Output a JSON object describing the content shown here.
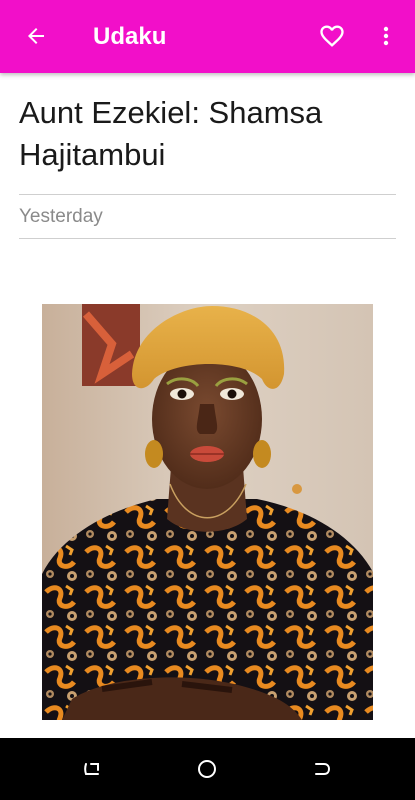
{
  "app_bar": {
    "title": "Udaku",
    "background": "#F20FC9",
    "back_icon": "arrow-back-icon",
    "favorite_icon": "heart-outline-icon",
    "menu_icon": "more-vert-icon"
  },
  "article": {
    "headline": "Aunt Ezekiel: Shamsa Hajitambui",
    "date": "Yesterday"
  },
  "nav_bar": {
    "recents_icon": "recents-icon",
    "home_icon": "home-circle-icon",
    "back_icon": "nav-back-icon"
  }
}
